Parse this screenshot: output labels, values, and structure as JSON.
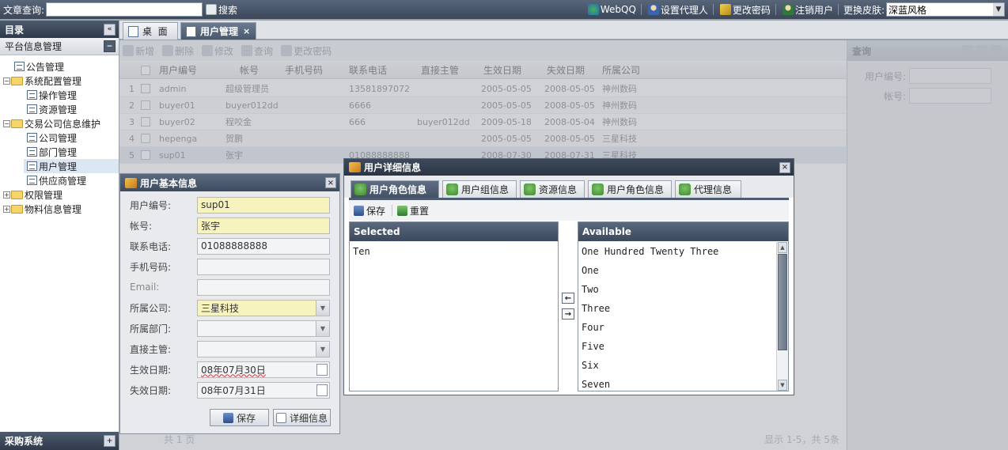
{
  "topbar": {
    "search_label": "文章查询:",
    "search_value": "",
    "search_button": "搜索",
    "webqq": "WebQQ",
    "set_agent": "设置代理人",
    "change_password": "更改密码",
    "logout": "注销用户",
    "skin_label": "更换皮肤:",
    "skin_value": "深蓝风格"
  },
  "sidebar": {
    "title": "目录",
    "section": "平台信息管理",
    "tree": [
      {
        "label": "公告管理"
      },
      {
        "label": "系统配置管理",
        "expand": "−"
      },
      {
        "label": "操作管理"
      },
      {
        "label": "资源管理"
      },
      {
        "label": "交易公司信息维护",
        "expand": "−"
      },
      {
        "label": "公司管理"
      },
      {
        "label": "部门管理"
      },
      {
        "label": "用户管理"
      },
      {
        "label": "供应商管理"
      },
      {
        "label": "权限管理",
        "expand": "+"
      },
      {
        "label": "物料信息管理",
        "expand": "+"
      }
    ],
    "bottom_section": "采购系统"
  },
  "tabs": [
    {
      "label": "桌  面"
    },
    {
      "label": "用户管理",
      "close": "×"
    }
  ],
  "grid": {
    "toolbar": [
      "新增",
      "删除",
      "修改",
      "查询",
      "更改密码"
    ],
    "columns": [
      "用户编号",
      "帐号",
      "手机号码",
      "联系电话",
      "直接主管",
      "生效日期",
      "失效日期",
      "所属公司"
    ],
    "rows": [
      {
        "num": "1",
        "id": "admin",
        "account": "超级管理员",
        "mobile": "",
        "phone": "13581897072",
        "manager": "",
        "start": "2005-05-05",
        "end": "2008-05-05",
        "company": "神州数码"
      },
      {
        "num": "2",
        "id": "buyer01",
        "account": "buyer012dd",
        "mobile": "",
        "phone": "6666",
        "manager": "",
        "start": "2005-05-05",
        "end": "2008-05-05",
        "company": "神州数码"
      },
      {
        "num": "3",
        "id": "buyer02",
        "account": "程咬金",
        "mobile": "",
        "phone": "666",
        "manager": "buyer012dd",
        "start": "2009-05-18",
        "end": "2008-05-04",
        "company": "神州数码"
      },
      {
        "num": "4",
        "id": "hepenga",
        "account": "贺鹏",
        "mobile": "",
        "phone": "",
        "manager": "",
        "start": "2005-05-05",
        "end": "2008-05-05",
        "company": "三星科技"
      },
      {
        "num": "5",
        "id": "sup01",
        "account": "张宇",
        "mobile": "",
        "phone": "01088888888",
        "manager": "",
        "start": "2008-07-30",
        "end": "2008-07-31",
        "company": "三星科技"
      }
    ],
    "footer": "显示 1-5，共 5条",
    "pager_text": "共 1 页"
  },
  "query_panel": {
    "title": "查询",
    "fields": [
      {
        "label": "用户编号:",
        "value": ""
      },
      {
        "label": "帐号:",
        "value": ""
      }
    ]
  },
  "basic_window": {
    "title": "用户基本信息",
    "fields": [
      {
        "label": "用户编号:",
        "value": "sup01"
      },
      {
        "label": "帐号:",
        "value": "张宇"
      },
      {
        "label": "联系电话:",
        "value": "01088888888"
      },
      {
        "label": "手机号码:",
        "value": ""
      },
      {
        "label": "Email:",
        "value": ""
      },
      {
        "label": "所属公司:",
        "value": "三星科技"
      },
      {
        "label": "所属部门:",
        "value": ""
      },
      {
        "label": "直接主管:",
        "value": ""
      },
      {
        "label": "生效日期:",
        "value": "08年07月30日"
      },
      {
        "label": "失效日期:",
        "value": "08年07月31日"
      }
    ],
    "save": "保存",
    "details": "详细信息"
  },
  "detail_window": {
    "title": "用户详细信息",
    "tabs": [
      "用户角色信息",
      "用户组信息",
      "资源信息",
      "用户角色信息",
      "代理信息"
    ],
    "save": "保存",
    "reset": "重置",
    "selected_header": "Selected",
    "selected_items": [
      "Ten"
    ],
    "available_header": "Available",
    "available_items": [
      "One Hundred Twenty Three",
      "One",
      "Two",
      "Three",
      "Four",
      "Five",
      "Six",
      "Seven"
    ],
    "move_left": "←",
    "move_right": "→"
  },
  "colors": {
    "header_dark": "#3c4759",
    "required_field": "#f7f3bf",
    "selection": "#dde6f3"
  }
}
